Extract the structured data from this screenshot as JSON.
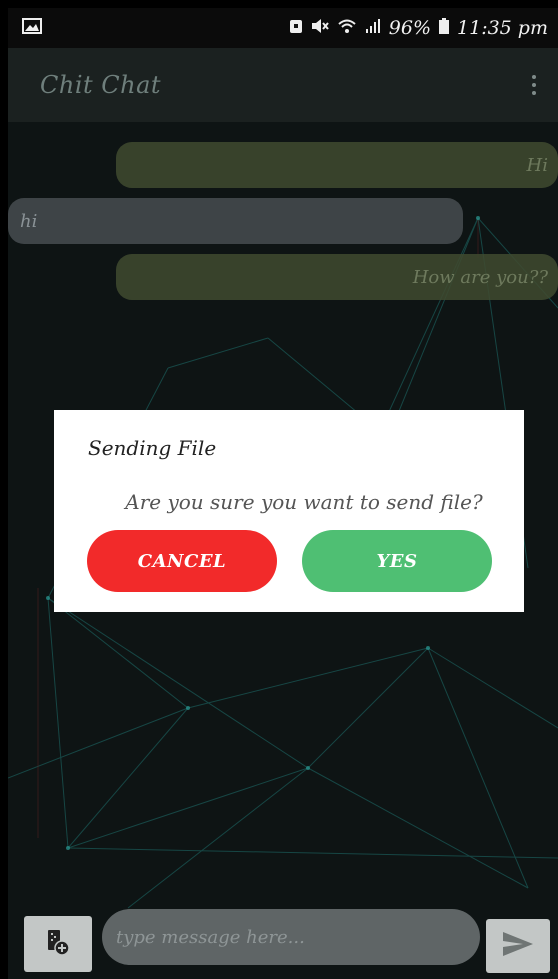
{
  "statusbar": {
    "battery": "96%",
    "time": "11:35 pm",
    "icons": [
      "image-icon",
      "alarm-icon",
      "mute-icon",
      "wifi-icon",
      "signal-icon",
      "battery-icon"
    ]
  },
  "appbar": {
    "title": "Chit Chat",
    "menu_icon": "overflow-menu-icon"
  },
  "messages": [
    {
      "side": "out",
      "text": "Hi"
    },
    {
      "side": "in",
      "text": "hi"
    },
    {
      "side": "out",
      "text": "How are you??"
    }
  ],
  "dialog": {
    "title": "Sending File",
    "message": "Are you sure you want to send file?",
    "cancel_label": "CANCEL",
    "yes_label": "YES"
  },
  "composer": {
    "placeholder": "type message here...",
    "attach_icon": "attach-file-icon",
    "send_icon": "send-icon"
  },
  "colors": {
    "cancel": "#f22a2a",
    "yes": "#4fbf73",
    "outgoing_bubble": "#3f4a2f",
    "incoming_bubble": "#464c50"
  }
}
